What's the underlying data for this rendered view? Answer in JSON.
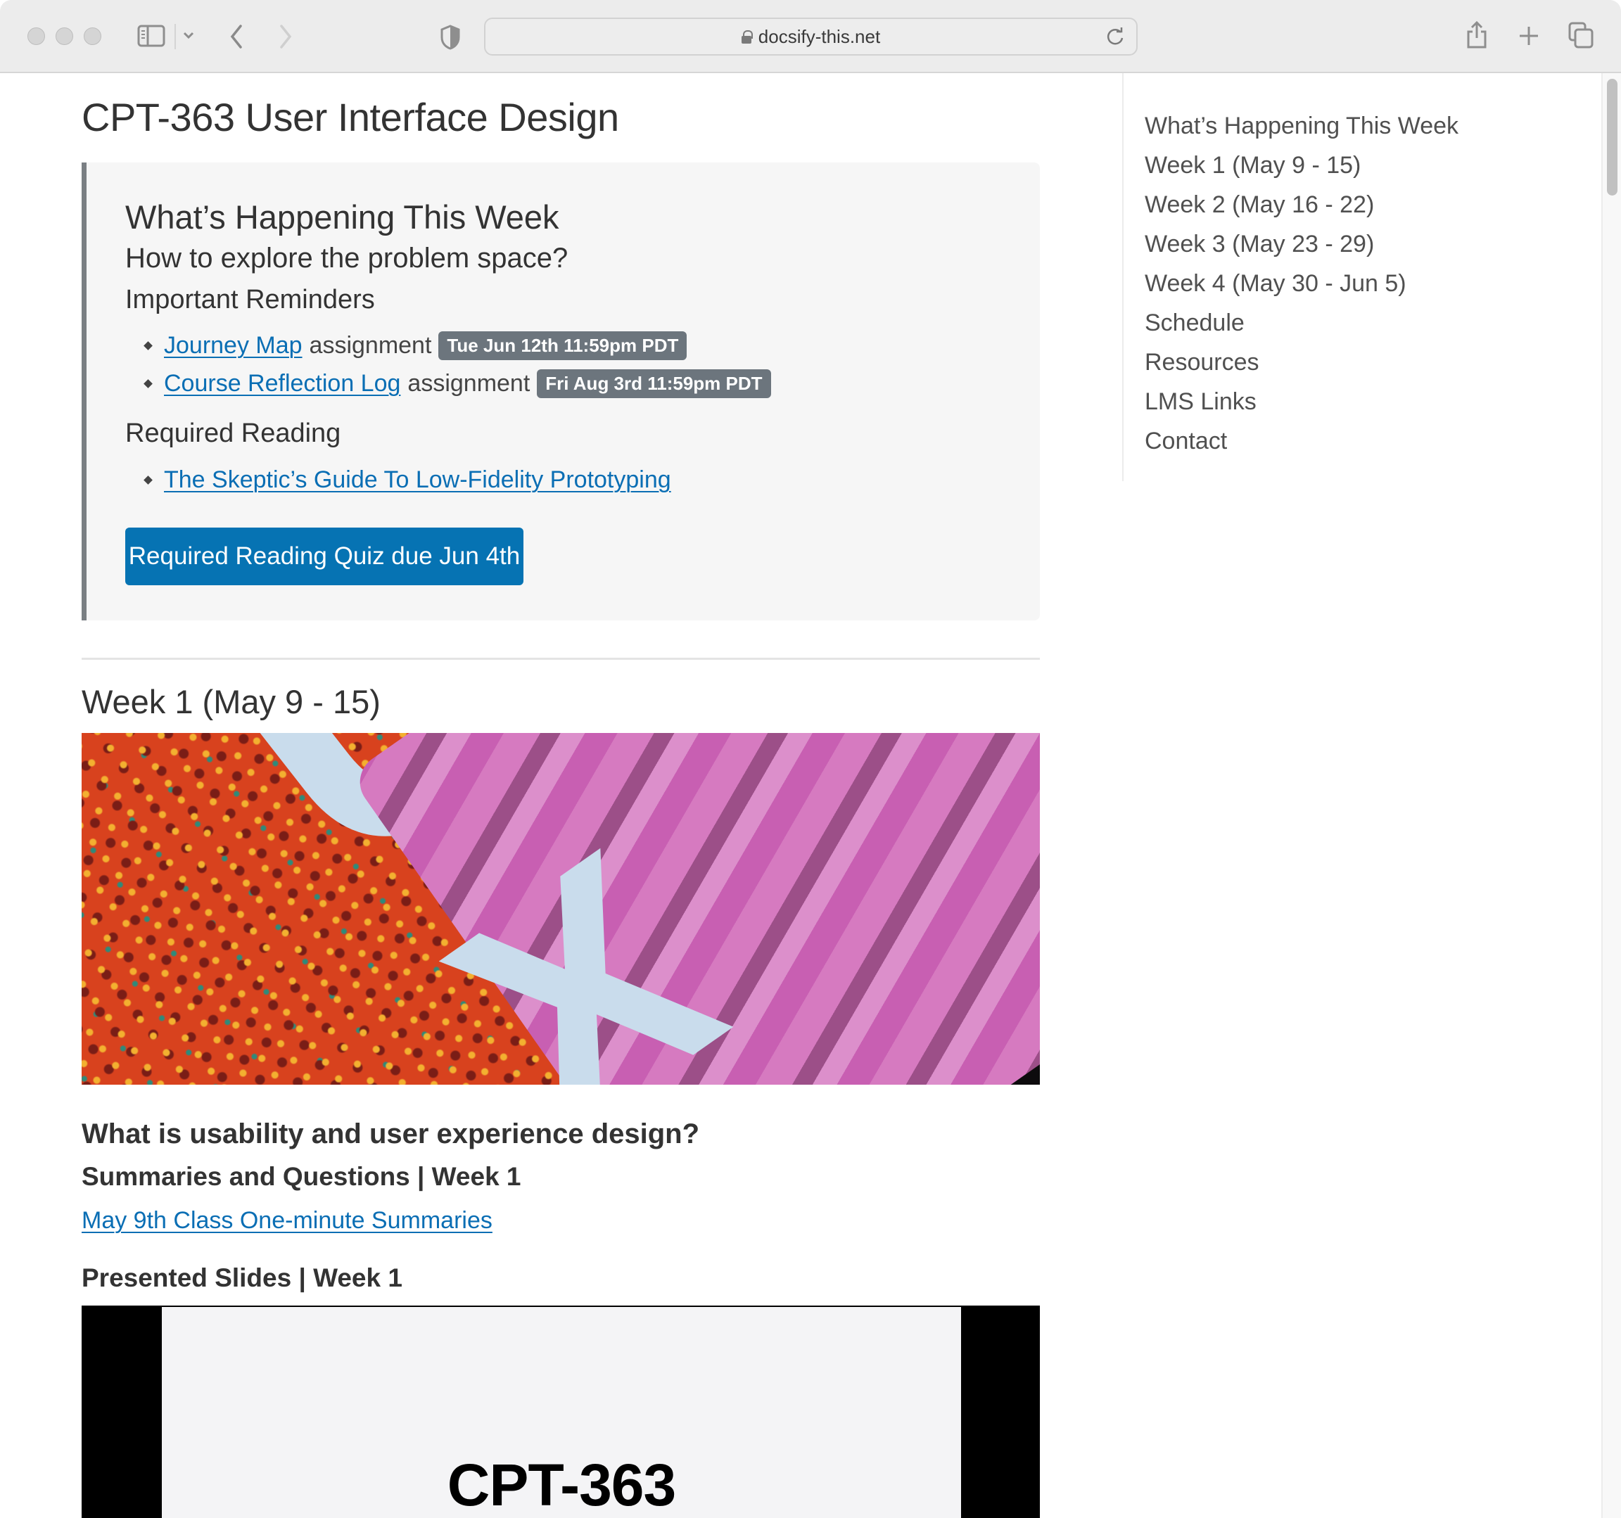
{
  "browser": {
    "url": "docsify-this.net",
    "icons": [
      "sidebar-toggle-icon",
      "chevron-down-icon",
      "back-icon",
      "forward-icon",
      "shield-icon",
      "lock-icon",
      "reload-icon",
      "share-icon",
      "new-tab-icon",
      "tab-overview-icon"
    ]
  },
  "page": {
    "title": "CPT-363 User Interface Design",
    "callout": {
      "heading": "What’s Happening This Week",
      "subheading": "How to explore the problem space?",
      "reminders_heading": "Important Reminders",
      "reminders": [
        {
          "link": "Journey Map",
          "text": "assignment",
          "badge": "Tue Jun 12th 11:59pm PDT"
        },
        {
          "link": "Course Reflection Log",
          "text": "assignment",
          "badge": "Fri Aug 3rd 11:59pm PDT"
        }
      ],
      "reading_heading": "Required Reading",
      "readings": [
        {
          "link": "The Skeptic’s Guide To Low-Fidelity Prototyping"
        }
      ],
      "quiz_button": "Required Reading Quiz due Jun 4th"
    },
    "week1": {
      "heading": "Week 1 (May 9 - 15)",
      "image_alt": "UX cards image",
      "image_glyphs": [
        "U",
        "X"
      ],
      "question": "What is usability and user experience design?",
      "summaries_heading": "Summaries and Questions | Week 1",
      "summaries_link": "May 9th Class One-minute Summaries",
      "slides_heading": "Presented Slides | Week 1",
      "slide_title": "CPT-363"
    }
  },
  "toc": [
    "What’s Happening This Week",
    "Week 1 (May 9 - 15)",
    "Week 2 (May 16 - 22)",
    "Week 3 (May 23 - 29)",
    "Week 4 (May 30 - Jun 5)",
    "Schedule",
    "Resources",
    "LMS Links",
    "Contact"
  ],
  "colors": {
    "link": "#0a6eb4",
    "button": "#0673b3",
    "badge": "#6c757d",
    "callout_border": "#7a7f83",
    "callout_bg": "#f6f6f6"
  }
}
